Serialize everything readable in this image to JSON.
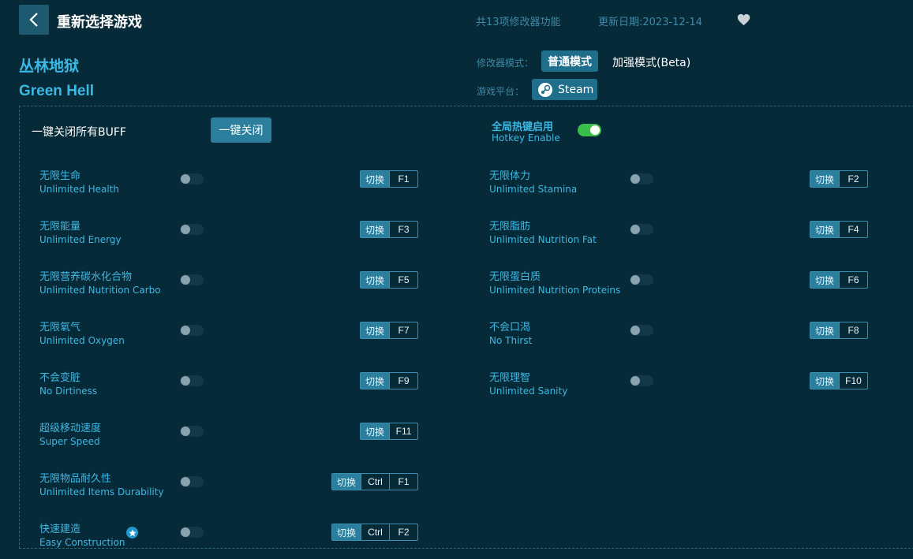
{
  "header": {
    "title": "重新选择游戏",
    "feature_count": "共13项修改器功能",
    "update_date": "更新日期:2023-12-14"
  },
  "game": {
    "name_cn": "丛林地狱",
    "name_en": "Green Hell"
  },
  "mode": {
    "label": "修改器模式：",
    "normal": "普通模式",
    "beta": "加强模式(Beta)"
  },
  "platform": {
    "label": "游戏平台：",
    "name": "Steam"
  },
  "controls": {
    "close_all_label": "一键关闭所有BUFF",
    "close_all_button": "一键关闭",
    "hotkey_cn": "全局热键启用",
    "hotkey_en": "Hotkey Enable",
    "hotkey_enabled": true
  },
  "switch_label": "切换",
  "features_left": [
    {
      "cn": "无限生命",
      "en": "Unlimited Health",
      "keys": [
        "F1"
      ],
      "enabled": false
    },
    {
      "cn": "无限能量",
      "en": "Unlimited Energy",
      "keys": [
        "F3"
      ],
      "enabled": false
    },
    {
      "cn": "无限营养碳水化合物",
      "en": "Unlimited Nutrition Carbo",
      "keys": [
        "F5"
      ],
      "enabled": false
    },
    {
      "cn": "无限氧气",
      "en": "Unlimited Oxygen",
      "keys": [
        "F7"
      ],
      "enabled": false
    },
    {
      "cn": "不会变脏",
      "en": "No Dirtiness",
      "keys": [
        "F9"
      ],
      "enabled": false
    },
    {
      "cn": "超级移动速度",
      "en": "Super Speed",
      "keys": [
        "F11"
      ],
      "enabled": false
    },
    {
      "cn": "无限物品耐久性",
      "en": "Unlimited Items Durability",
      "keys": [
        "Ctrl",
        "F1"
      ],
      "enabled": false
    },
    {
      "cn": "快速建造",
      "en": "Easy Construction",
      "keys": [
        "Ctrl",
        "F2"
      ],
      "enabled": false
    }
  ],
  "features_right": [
    {
      "cn": "无限体力",
      "en": "Unlimited Stamina",
      "keys": [
        "F2"
      ],
      "enabled": false
    },
    {
      "cn": "无限脂肪",
      "en": "Unlimited Nutrition Fat",
      "keys": [
        "F4"
      ],
      "enabled": false
    },
    {
      "cn": "无限蛋白质",
      "en": "Unlimited Nutrition Proteins",
      "keys": [
        "F6"
      ],
      "enabled": false
    },
    {
      "cn": "不会口渴",
      "en": "No Thirst",
      "keys": [
        "F8"
      ],
      "enabled": false
    },
    {
      "cn": "无限理智",
      "en": "Unlimited Sanity",
      "keys": [
        "F10"
      ],
      "enabled": false
    }
  ],
  "icons": {
    "back": "chevron-left-icon",
    "favorite": "heart-icon",
    "platform": "steam-icon",
    "premium": "star-icon"
  },
  "colors": {
    "background": "#072a38",
    "accent": "#3cb8e4",
    "button": "#1f6f8c",
    "toggle_on": "#3bbf4b"
  }
}
